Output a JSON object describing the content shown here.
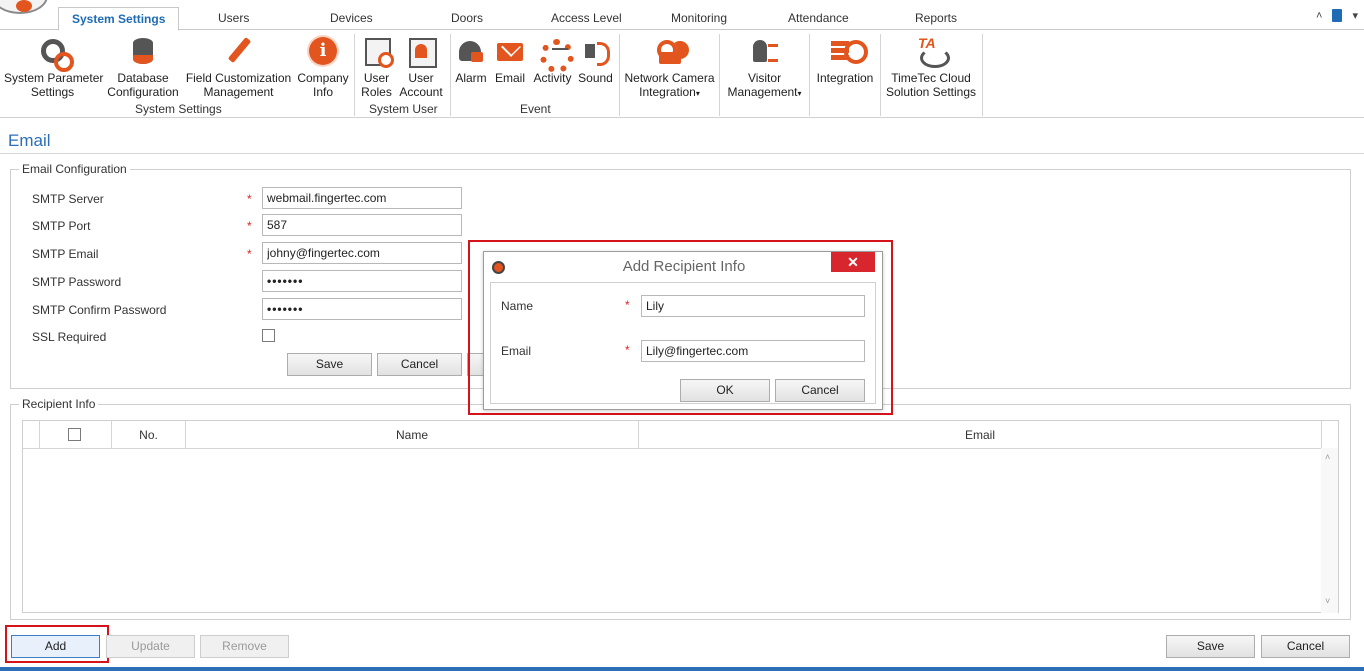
{
  "tabs": [
    {
      "label": "System Settings",
      "active": true
    },
    {
      "label": "Users"
    },
    {
      "label": "Devices"
    },
    {
      "label": "Doors"
    },
    {
      "label": "Access Level"
    },
    {
      "label": "Monitoring"
    },
    {
      "label": "Attendance"
    },
    {
      "label": "Reports"
    }
  ],
  "topright": {
    "collapse_glyph": "˄",
    "menu_glyph": "▾"
  },
  "ribbon": {
    "system_settings": {
      "group_label": "System Settings",
      "buttons": [
        {
          "line1": "System Parameter",
          "line2": "Settings",
          "icon": "gears-icon"
        },
        {
          "line1": "Database",
          "line2": "Configuration",
          "icon": "database-icon"
        },
        {
          "line1": "Field Customization",
          "line2": "Management",
          "icon": "pen-icon"
        },
        {
          "line1": "Company",
          "line2": "Info",
          "icon": "info-icon"
        }
      ]
    },
    "system_user": {
      "group_label": "System User",
      "buttons": [
        {
          "line1": "User",
          "line2": "Roles",
          "icon": "user-roles-icon"
        },
        {
          "line1": "User",
          "line2": "Account",
          "icon": "user-account-icon"
        }
      ]
    },
    "event": {
      "group_label": "Event",
      "buttons": [
        {
          "line1": "Alarm",
          "icon": "alarm-icon"
        },
        {
          "line1": "Email",
          "icon": "email-icon"
        },
        {
          "line1": "Activity",
          "icon": "activity-icon"
        },
        {
          "line1": "Sound",
          "icon": "sound-icon"
        }
      ]
    },
    "other": [
      {
        "line1": "Network Camera",
        "line2": "Integration",
        "dropdown": true,
        "icon": "camera-icon"
      },
      {
        "line1": "Visitor",
        "line2": "Management",
        "dropdown": true,
        "icon": "visitor-icon"
      },
      {
        "line1": "Integration",
        "icon": "integration-icon"
      },
      {
        "line1": "TimeTec Cloud",
        "line2": "Solution Settings",
        "icon": "timetec-icon"
      }
    ],
    "dropdown_glyph": "▾"
  },
  "page": {
    "title": "Email"
  },
  "email_config": {
    "legend": "Email Configuration",
    "required_mark": "*",
    "fields": {
      "smtp_server": {
        "label": "SMTP Server",
        "value": "webmail.fingertec.com",
        "required": true
      },
      "smtp_port": {
        "label": "SMTP Port",
        "value": "587",
        "required": true
      },
      "smtp_email": {
        "label": "SMTP Email",
        "value": "johny@fingertec.com",
        "required": true
      },
      "smtp_password": {
        "label": "SMTP Password",
        "value": "•••••••"
      },
      "smtp_confirm_password": {
        "label": "SMTP Confirm Password",
        "value": "•••••••"
      },
      "ssl_required": {
        "label": "SSL Required",
        "checked": false
      }
    },
    "save_label": "Save",
    "cancel_label": "Cancel"
  },
  "recipient_info": {
    "legend": "Recipient Info",
    "columns": {
      "no": "No.",
      "name": "Name",
      "email": "Email"
    },
    "rows": [],
    "scroll_up": "˄",
    "scroll_down": "˅"
  },
  "footer": {
    "add_label": "Add",
    "update_label": "Update",
    "remove_label": "Remove",
    "save_label": "Save",
    "cancel_label": "Cancel"
  },
  "dialog": {
    "title": "Add Recipient Info",
    "close_glyph": "✕",
    "name_label": "Name",
    "name_value": "Lily",
    "email_label": "Email",
    "email_value": "Lily@fingertec.com",
    "required_mark": "*",
    "ok_label": "OK",
    "cancel_label": "Cancel"
  },
  "colors": {
    "accent": "#1f6cb4",
    "brand": "#e2551f",
    "highlight": "#d4131b",
    "close": "#d7262d"
  }
}
